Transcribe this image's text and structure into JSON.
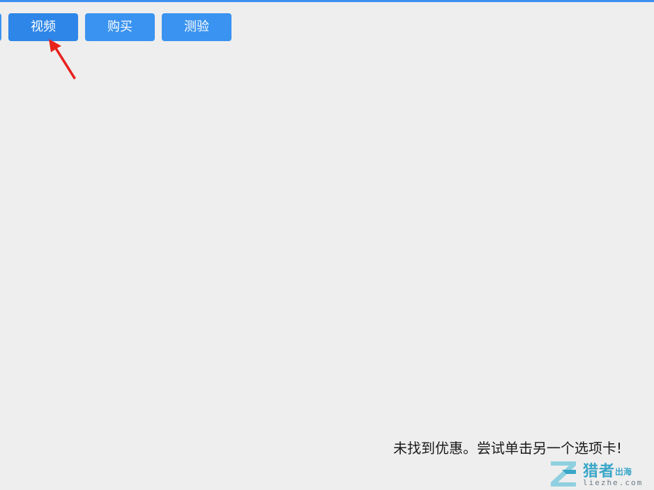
{
  "tabs": [
    {
      "label": ""
    },
    {
      "label": "视频"
    },
    {
      "label": "购买"
    },
    {
      "label": "测验"
    }
  ],
  "main": {
    "empty_message": "未找到优惠。尝试单击另一个选项卡!"
  },
  "watermark": {
    "name": "猎者",
    "sub": "出海",
    "domain": "liezhe.com"
  },
  "colors": {
    "accent": "#3a93f0",
    "active_tab": "#2e86e8",
    "annotation_arrow": "#e8231e",
    "background": "#eeeeee"
  },
  "icons": {
    "annotation": "red-arrow-icon",
    "watermark_logo": "z-logo-icon"
  }
}
